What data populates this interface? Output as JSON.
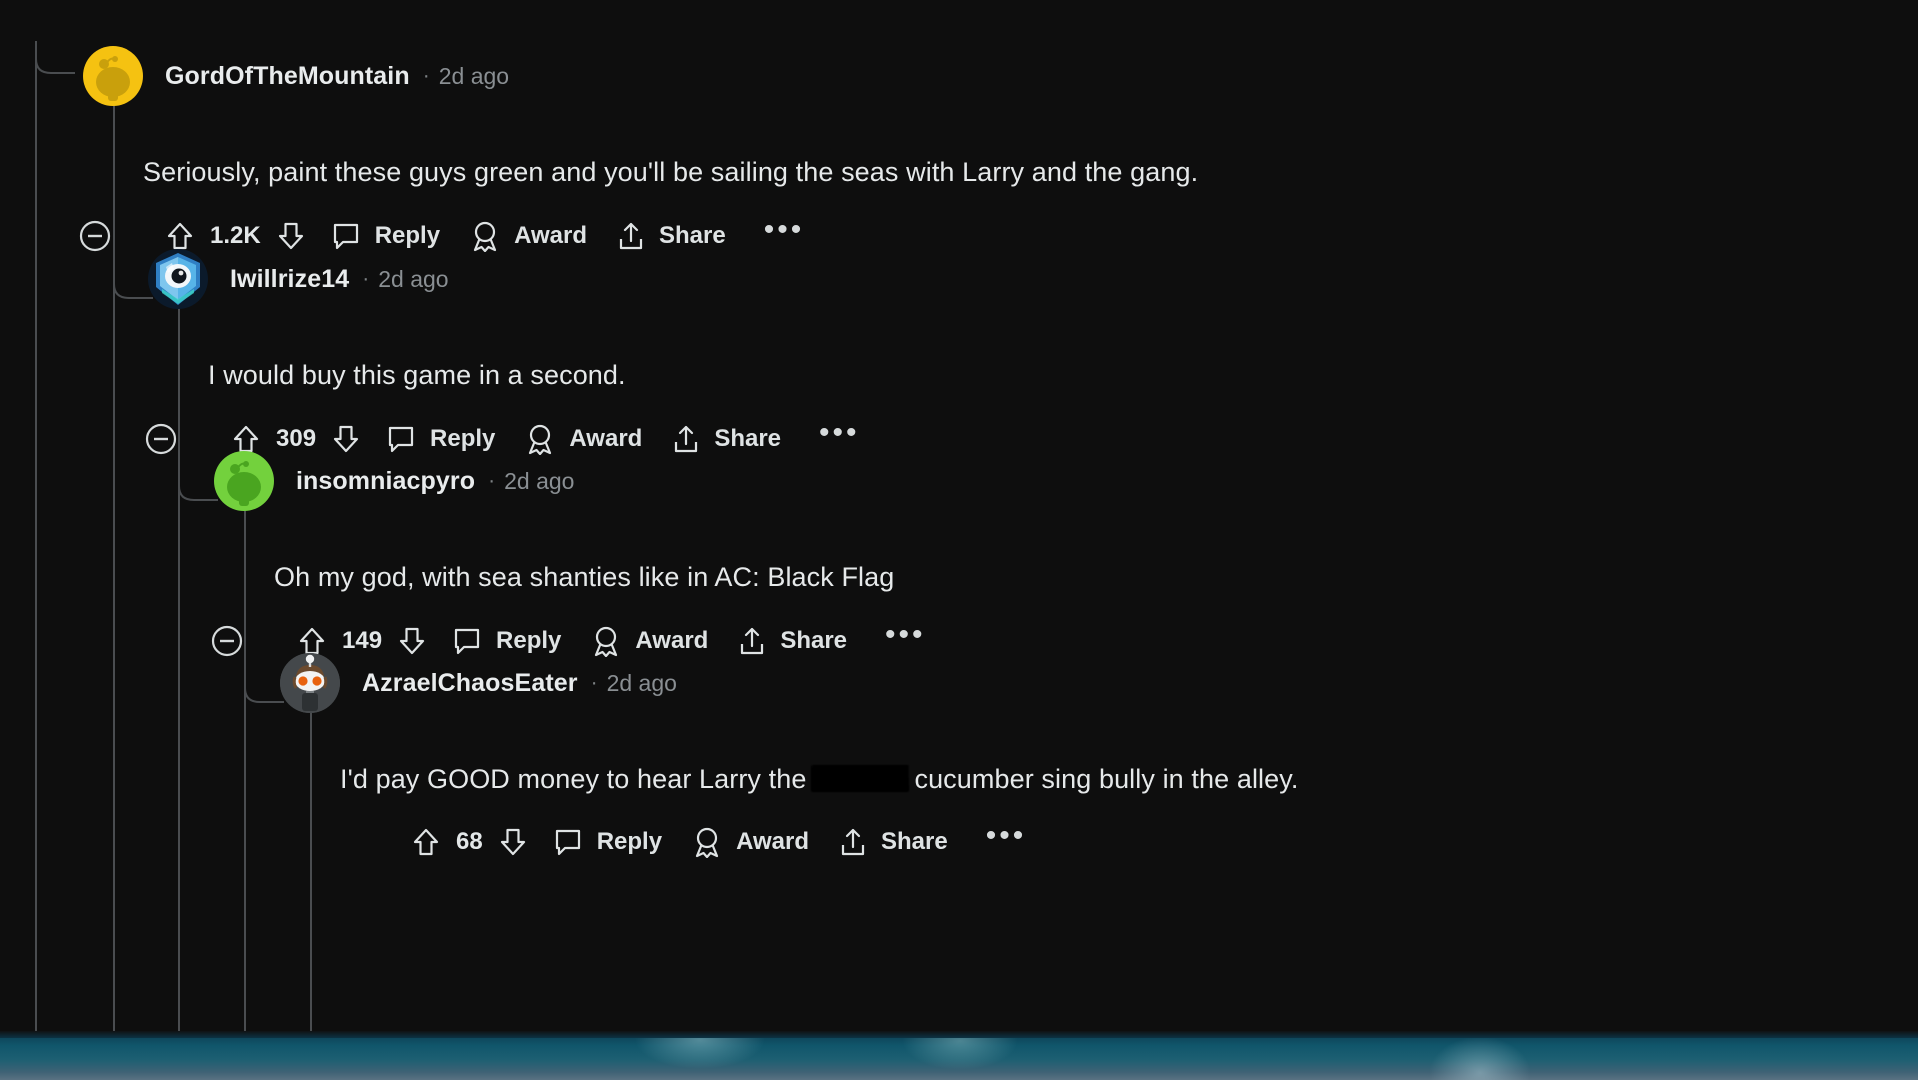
{
  "app": "reddit-comment-thread",
  "theme": {
    "background": "#0e0e0e",
    "text": "#e6e9ea",
    "muted": "#8a8f93",
    "threadline": "#4a4d50"
  },
  "banner": {
    "top_color": "#23497a",
    "bottom_color": "#12566b"
  },
  "action_labels": {
    "reply": "Reply",
    "award": "Award",
    "share": "Share",
    "more": "•••"
  },
  "comments": [
    {
      "id": "c1",
      "depth": 1,
      "username": "GordOfTheMountain",
      "separator": "·",
      "timestamp": "2d ago",
      "avatar": "snoo-yellow-avatar",
      "avatar_color": "#f5c211",
      "body": "Seriously, paint these guys green and you'll be sailing the seas with Larry and the gang.",
      "score": "1.2K",
      "has_collapse": true,
      "reply": "Reply",
      "award": "Award",
      "share": "Share",
      "more": "•••"
    },
    {
      "id": "c2",
      "depth": 2,
      "username": "Iwillrize14",
      "separator": "·",
      "timestamp": "2d ago",
      "avatar": "game-shield-avatar",
      "avatar_color": "#3aa0dd",
      "body": "I would buy this game in a second.",
      "score": "309",
      "has_collapse": true,
      "reply": "Reply",
      "award": "Award",
      "share": "Share",
      "more": "•••"
    },
    {
      "id": "c3",
      "depth": 3,
      "username": "insomniacpyro",
      "separator": "·",
      "timestamp": "2d ago",
      "avatar": "snoo-green-avatar",
      "avatar_color": "#73d13d",
      "body": "Oh my god, with sea shanties like in AC: Black Flag",
      "score": "149",
      "has_collapse": true,
      "reply": "Reply",
      "award": "Award",
      "share": "Share",
      "more": "•••"
    },
    {
      "id": "c4",
      "depth": 4,
      "username": "AzraelChaosEater",
      "separator": "·",
      "timestamp": "2d ago",
      "avatar": "snoo-dark-orange-eyes-avatar",
      "avatar_color": "#4b4f52",
      "body_before_redaction": "I'd pay GOOD money to hear Larry the",
      "body_after_redaction": "cucumber sing bully in the alley.",
      "redaction": "redacted-scribble",
      "score": "68",
      "has_collapse": false,
      "reply": "Reply",
      "award": "Award",
      "share": "Share",
      "more": "•••"
    }
  ]
}
